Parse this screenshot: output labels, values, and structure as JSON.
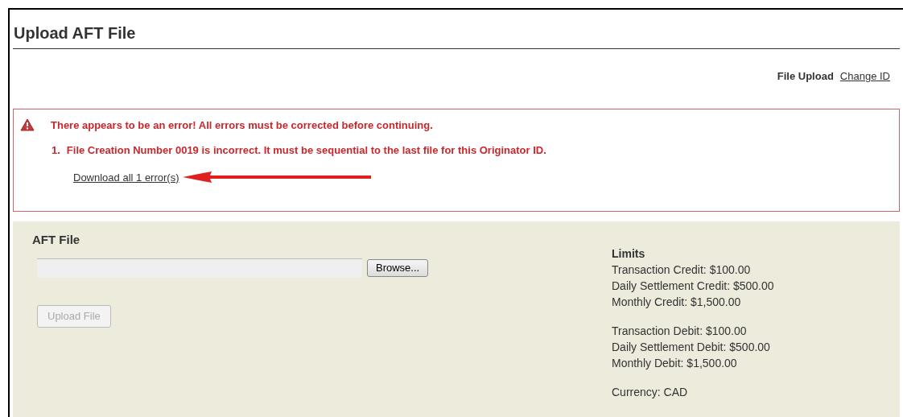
{
  "page": {
    "title": "Upload AFT File"
  },
  "nav": {
    "label": "File Upload",
    "link": "Change ID"
  },
  "error": {
    "heading": "There appears to be an error! All errors must be corrected before continuing.",
    "items": [
      {
        "number": "1.",
        "text": "File Creation Number 0019 is incorrect. It must be sequential to the last file for this Originator ID."
      }
    ],
    "download_link": "Download all 1 error(s)"
  },
  "upload": {
    "heading": "AFT File",
    "browse_button": "Browse...",
    "upload_button": {
      "label": "Upload File",
      "disabled": true
    }
  },
  "limits": {
    "heading": "Limits",
    "groups": [
      [
        "Transaction Credit: $100.00",
        "Daily Settlement Credit: $500.00",
        "Monthly Credit: $1,500.00"
      ],
      [
        "Transaction Debit: $100.00",
        "Daily Settlement Debit: $500.00",
        "Monthly Debit: $1,500.00"
      ],
      [
        "Currency: CAD"
      ]
    ]
  }
}
